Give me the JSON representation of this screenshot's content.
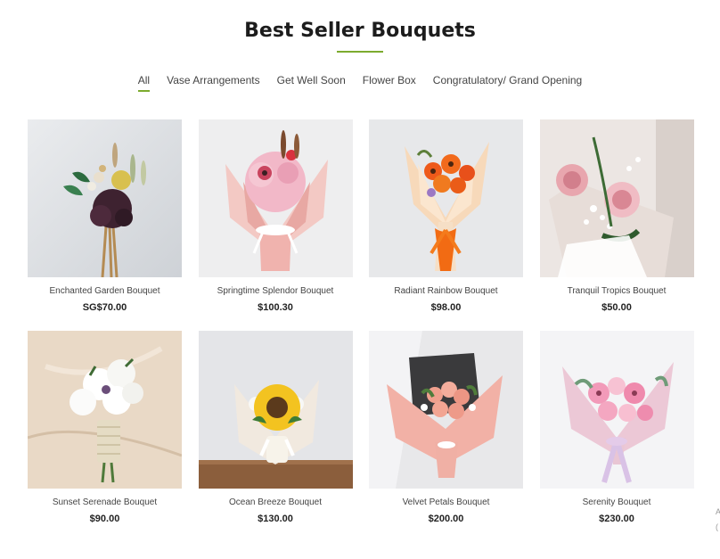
{
  "section": {
    "title": "Best Seller Bouquets"
  },
  "tabs": [
    {
      "label": "All",
      "active": true
    },
    {
      "label": "Vase Arrangements",
      "active": false
    },
    {
      "label": "Get Well Soon",
      "active": false
    },
    {
      "label": "Flower Box",
      "active": false
    },
    {
      "label": "Congratulatory/ Grand Opening",
      "active": false
    }
  ],
  "products": [
    {
      "name": "Enchanted Garden Bouquet",
      "price": "SG$70.00"
    },
    {
      "name": "Springtime Splendor Bouquet",
      "price": "$100.30"
    },
    {
      "name": "Radiant Rainbow Bouquet",
      "price": "$98.00"
    },
    {
      "name": "Tranquil Tropics Bouquet",
      "price": "$50.00"
    },
    {
      "name": "Sunset Serenade Bouquet",
      "price": "$90.00"
    },
    {
      "name": "Ocean Breeze Bouquet",
      "price": "$130.00"
    },
    {
      "name": "Velvet Petals Bouquet",
      "price": "$200.00"
    },
    {
      "name": "Serenity Bouquet",
      "price": "$230.00"
    }
  ],
  "edge": {
    "line1": "A",
    "line2": "("
  },
  "colors": {
    "accent": "#7cab2e"
  }
}
